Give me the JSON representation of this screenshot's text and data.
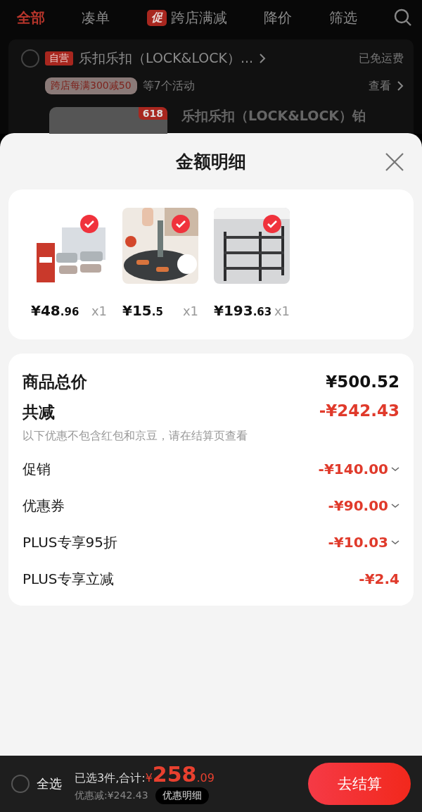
{
  "tabs": [
    {
      "label": "全部",
      "selected": true
    },
    {
      "label": "凑单",
      "selected": false
    },
    {
      "label": "跨店满减",
      "selected": false,
      "badge": "促"
    },
    {
      "label": "降价",
      "selected": false
    },
    {
      "label": "筛选",
      "selected": false
    }
  ],
  "store": {
    "checked": false,
    "badge": "自营",
    "name": "乐扣乐扣（LOCK&LOCK）...",
    "shipping": "已免运费",
    "promo_tag": "跨店每满300减50",
    "promo_note": "等7个活动",
    "view": "查看"
  },
  "product_peek": {
    "tag": "618",
    "title": "乐扣乐扣（LOCK&LOCK）铂"
  },
  "sheet": {
    "title": "金额明细",
    "items": [
      {
        "price_int": "¥48",
        "price_dec": ".96",
        "qty": "x1",
        "checked": true
      },
      {
        "price_int": "¥15",
        "price_dec": ".5",
        "qty": "x1",
        "checked": true
      },
      {
        "price_int": "¥193",
        "price_dec": ".63",
        "qty": "x1",
        "checked": true
      }
    ],
    "breakdown": [
      {
        "kind": "total",
        "label": "商品总价",
        "amount": "¥500.52"
      },
      {
        "kind": "reduction",
        "label": "共减",
        "amount": "-¥242.43",
        "note": "以下优惠不包含红包和京豆，请在结算页查看"
      },
      {
        "kind": "line",
        "label": "促销",
        "amount": "-¥140.00",
        "expandable": true
      },
      {
        "kind": "line",
        "label": "优惠券",
        "amount": "-¥90.00",
        "expandable": true
      },
      {
        "kind": "line",
        "label": "PLUS专享95折",
        "amount": "-¥10.03",
        "expandable": true
      },
      {
        "kind": "line",
        "label": "PLUS专享立减",
        "amount": "-¥2.4",
        "expandable": false
      }
    ]
  },
  "bottom_bar": {
    "select_all": {
      "label": "全选",
      "checked": false
    },
    "summary_label": "已选3件,合计:",
    "currency": "¥",
    "total_int": "258",
    "total_dec": ".09",
    "discount": "优惠减:¥242.43",
    "detail_button": "优惠明细",
    "checkout": "去结算"
  }
}
